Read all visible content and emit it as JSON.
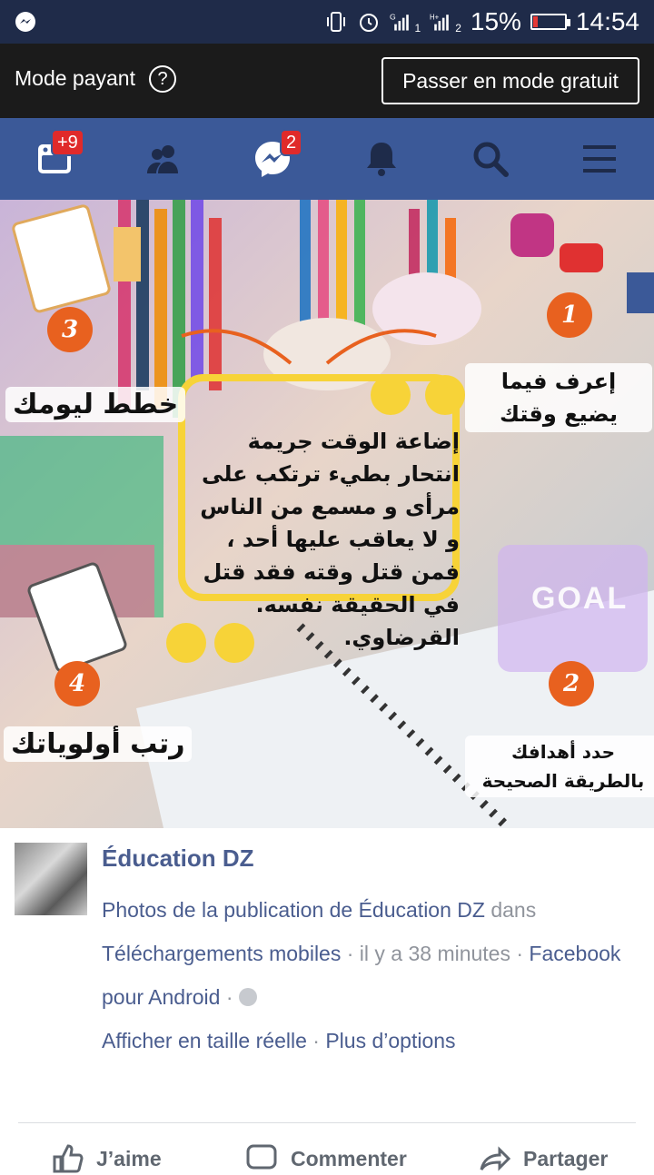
{
  "status_bar": {
    "battery_percent": "15%",
    "battery_level": 0.15,
    "time": "14:54",
    "icons": [
      "messenger-icon",
      "vibrate-icon",
      "alarm-icon",
      "signal-sim1-icon",
      "signal-sim2-icon",
      "battery-icon"
    ],
    "sim1_label": "1",
    "sim2_label": "2",
    "network1": "G",
    "network2": "H+"
  },
  "mode_bar": {
    "label": "Mode payant",
    "help_glyph": "?",
    "switch_button": "Passer en mode gratuit"
  },
  "nav": {
    "items": [
      {
        "name": "news-feed",
        "icon": "news-feed-icon",
        "badge": "+9"
      },
      {
        "name": "friends",
        "icon": "friends-icon",
        "badge": ""
      },
      {
        "name": "messenger",
        "icon": "messenger-icon",
        "badge": "2"
      },
      {
        "name": "notifications",
        "icon": "bell-icon",
        "badge": ""
      },
      {
        "name": "search",
        "icon": "search-icon",
        "badge": ""
      },
      {
        "name": "menu",
        "icon": "menu-icon",
        "badge": ""
      }
    ],
    "accent": "#3b5998"
  },
  "photo": {
    "quote": "إضاعة الوقت جريمة انتحار بطيء ترتكب على مرأى و مسمع من الناس و لا يعاقب عليها أحد ، فمن قتل وقته فقد قتل في الحقيقة نفسه. القرضاوي.",
    "label_1": "إعرف فيما يضيع وقتك",
    "label_2": "حدد أهدافك بالطريقة الصحيحة",
    "label_3": "خطط ليومك",
    "label_4": "رتب أولوياتك",
    "num_1": "1",
    "num_2": "2",
    "num_3": "3",
    "num_4": "4",
    "goal_text": "GOAL"
  },
  "post": {
    "page_name": "Éducation DZ",
    "line1_link": "Photos de la publication de Éducation DZ",
    "line1_rest": " dans",
    "line2_link": "Téléchargements mobiles",
    "line2_sep": " · il y a 38 minutes · ",
    "line2_app": "Facebook",
    "line3_app": "pour Android",
    "line3_sep": " · ",
    "line4_full": "Afficher en taille réelle",
    "line4_sep": " · ",
    "line4_more": "Plus d’options"
  },
  "actions": {
    "like": "J’aime",
    "comment": "Commenter",
    "share": "Partager"
  }
}
